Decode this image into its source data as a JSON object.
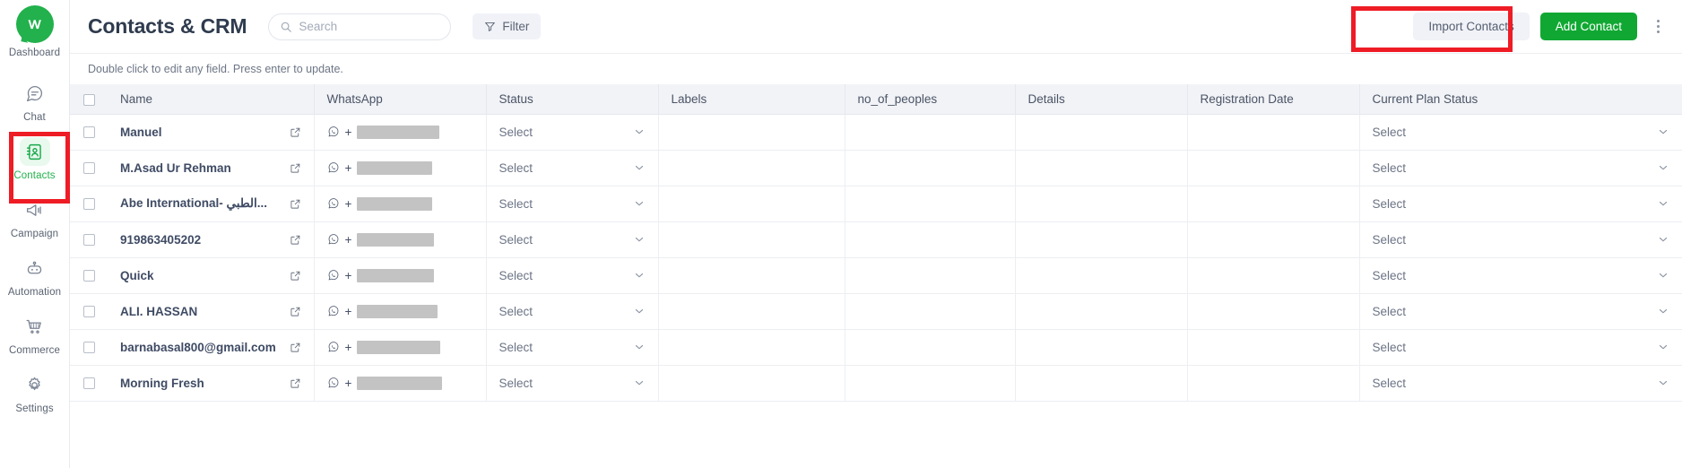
{
  "sidebar": {
    "brand": {
      "label": "Dashboard",
      "icon": "whatsapp-logo-icon",
      "color": "#22b14c"
    },
    "items": [
      {
        "label": "Chat",
        "icon": "chat-bubble-icon",
        "active": false
      },
      {
        "label": "Contacts",
        "icon": "contacts-book-icon",
        "active": true
      },
      {
        "label": "Campaign",
        "icon": "megaphone-icon",
        "active": false
      },
      {
        "label": "Automation",
        "icon": "robot-icon",
        "active": false
      },
      {
        "label": "Commerce",
        "icon": "shopping-cart-icon",
        "active": false
      },
      {
        "label": "Settings",
        "icon": "gear-icon",
        "active": false
      }
    ]
  },
  "header": {
    "title": "Contacts & CRM",
    "search": {
      "placeholder": "Search",
      "value": "",
      "icon": "search-icon"
    },
    "filter": {
      "label": "Filter",
      "icon": "funnel-icon"
    },
    "import_label": "Import Contacts",
    "add_label": "Add Contact",
    "kebab": "more-options-icon",
    "hint": "Double click to edit any field. Press enter to update."
  },
  "table": {
    "columns": [
      "Name",
      "WhatsApp",
      "Status",
      "Labels",
      "no_of_peoples",
      "Details",
      "Registration Date",
      "Current Plan Status"
    ],
    "select_placeholder": "Select",
    "phone_prefix": "+",
    "rows": [
      {
        "name": "Manuel",
        "phone_masked_width": 92,
        "status": "Select",
        "labels": "",
        "no_of_peoples": "",
        "details": "",
        "registration_date": "",
        "current_plan_status": "Select"
      },
      {
        "name": "M.Asad Ur Rehman",
        "phone_masked_width": 84,
        "status": "Select",
        "labels": "",
        "no_of_peoples": "",
        "details": "",
        "registration_date": "",
        "current_plan_status": "Select"
      },
      {
        "name": "Abe International- الطبي...",
        "phone_masked_width": 84,
        "status": "Select",
        "labels": "",
        "no_of_peoples": "",
        "details": "",
        "registration_date": "",
        "current_plan_status": "Select"
      },
      {
        "name": "919863405202",
        "phone_masked_width": 86,
        "status": "Select",
        "labels": "",
        "no_of_peoples": "",
        "details": "",
        "registration_date": "",
        "current_plan_status": "Select"
      },
      {
        "name": "Quick",
        "phone_masked_width": 86,
        "status": "Select",
        "labels": "",
        "no_of_peoples": "",
        "details": "",
        "registration_date": "",
        "current_plan_status": "Select"
      },
      {
        "name": "ALI. HASSAN",
        "phone_masked_width": 90,
        "status": "Select",
        "labels": "",
        "no_of_peoples": "",
        "details": "",
        "registration_date": "",
        "current_plan_status": "Select"
      },
      {
        "name": "barnabasal800@gmail.com",
        "phone_masked_width": 93,
        "status": "Select",
        "labels": "",
        "no_of_peoples": "",
        "details": "",
        "registration_date": "",
        "current_plan_status": "Select"
      },
      {
        "name": "Morning Fresh",
        "phone_masked_width": 95,
        "status": "Select",
        "labels": "",
        "no_of_peoples": "",
        "details": "",
        "registration_date": "",
        "current_plan_status": "Select"
      }
    ]
  },
  "annotations": {
    "highlight_color": "#ee1c25",
    "boxes": [
      "sidebar-contacts",
      "import-contacts-button"
    ]
  }
}
